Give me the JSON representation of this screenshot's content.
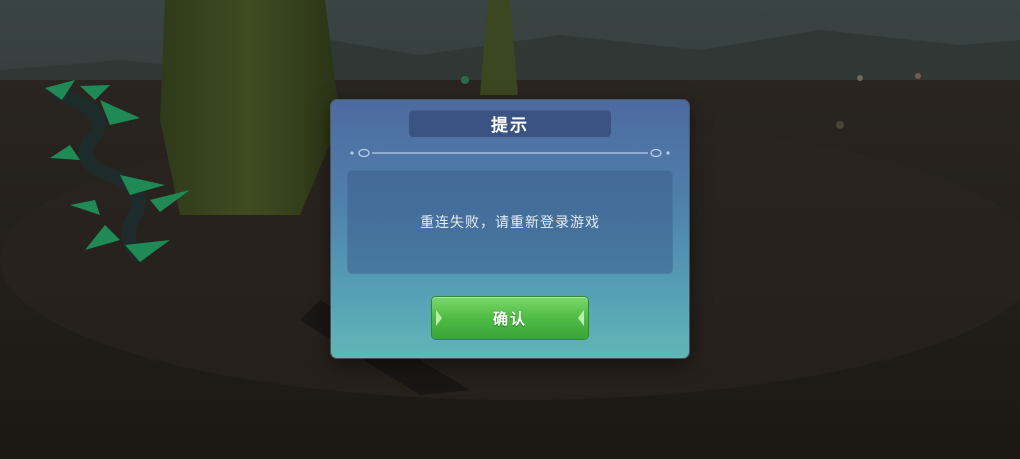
{
  "dialog": {
    "title": "提示",
    "message": "重连失败，请重新登录游戏",
    "confirm_label": "确认"
  },
  "colors": {
    "dialog_top": "#4e6aa0",
    "dialog_bottom": "#62b6b6",
    "title_bar": "#3a5383",
    "confirm_button": "#4fbb45"
  },
  "icons": [
    "divider-ornament-icon",
    "chevron-left-icon",
    "chevron-right-icon"
  ]
}
